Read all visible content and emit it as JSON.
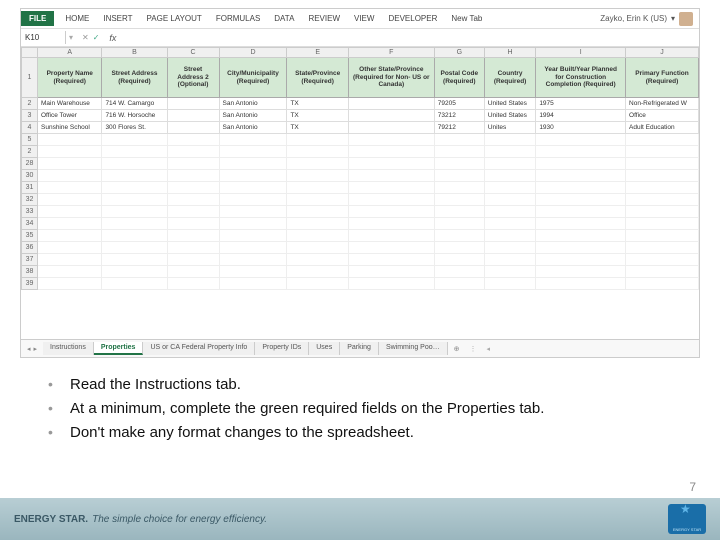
{
  "ribbon": {
    "file": "FILE",
    "tabs": [
      "HOME",
      "INSERT",
      "PAGE LAYOUT",
      "FORMULAS",
      "DATA",
      "REVIEW",
      "VIEW",
      "DEVELOPER",
      "New Tab"
    ],
    "user": "Zayko, Erin K (US)"
  },
  "formula": {
    "namebox": "K10",
    "fx": "fx"
  },
  "col_letters": [
    "A",
    "B",
    "C",
    "D",
    "E",
    "F",
    "G",
    "H",
    "I",
    "J"
  ],
  "headers": [
    "Property Name (Required)",
    "Street Address (Required)",
    "Street Address 2 (Optional)",
    "City/Municipality (Required)",
    "State/Province (Required)",
    "Other State/Province (Required for Non- US or Canada)",
    "Postal Code (Required)",
    "Country (Required)",
    "Year Built/Year Planned for Construction Completion (Required)",
    "Primary Function (Required)"
  ],
  "rows": [
    {
      "n": "2",
      "c": [
        "Main Warehouse",
        "714 W. Camargo",
        "",
        "San Antonio",
        "TX",
        "",
        "79205",
        "United States",
        "1975",
        "Non-Refrigerated W"
      ]
    },
    {
      "n": "3",
      "c": [
        "Office Tower",
        "716 W. Horsoche",
        "",
        "San Antonio",
        "TX",
        "",
        "73212",
        "United States",
        "1994",
        "Office"
      ]
    },
    {
      "n": "4",
      "c": [
        "Sunshine School",
        "300 Flores St.",
        "",
        "San Antonio",
        "TX",
        "",
        "79212",
        "Unites",
        "1930",
        "Adult Education"
      ]
    }
  ],
  "empty_rows": [
    "5",
    "2",
    "28",
    "30",
    "31",
    "32",
    "33",
    "34",
    "35",
    "36",
    "37",
    "38",
    "39"
  ],
  "sheets": [
    "Instructions",
    "Properties",
    "US or CA Federal Property Info",
    "Property IDs",
    "Uses",
    "Parking",
    "Swimming Poo…"
  ],
  "sheets_active": 1,
  "bullets": [
    "Read the Instructions tab.",
    "At a minimum, complete the green required fields on the Properties tab.",
    "Don't make any format changes to the spreadsheet."
  ],
  "footer": {
    "brand": "ENERGY STAR.",
    "tag": "The simple choice for energy efficiency."
  },
  "pagenum": "7"
}
